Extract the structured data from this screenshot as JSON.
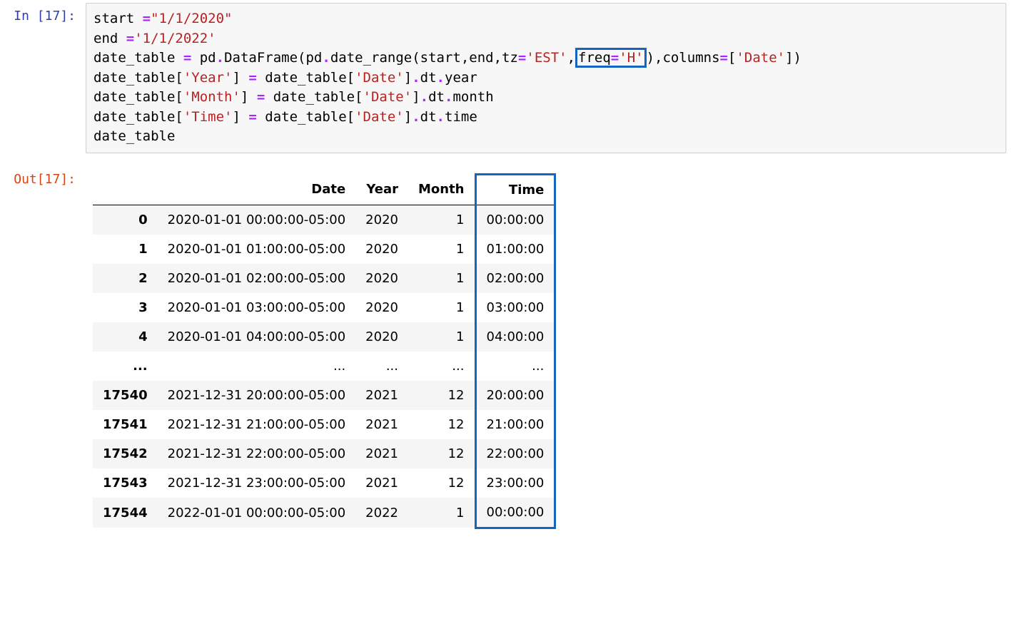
{
  "prompts": {
    "in_label": "In [17]:",
    "out_label": "Out[17]:"
  },
  "code": {
    "l1_a": "start ",
    "l1_eq": "=",
    "l1_b": "\"1/1/2020\"",
    "l2_a": "end ",
    "l2_eq": "=",
    "l2_b": "'1/1/2022'",
    "l3_a": "date_table ",
    "l3_eq": "=",
    "l3_b": " pd",
    "l3_c": ".",
    "l3_d": "DataFrame(pd",
    "l3_e": ".",
    "l3_f": "date_range(start,end,tz",
    "l3_eq2": "=",
    "l3_g": "'EST'",
    "l3_h": ",",
    "l3_hl_a": "freq",
    "l3_hl_eq": "=",
    "l3_hl_b": "'H'",
    "l3_i": "),columns",
    "l3_eq3": "=",
    "l3_j": "[",
    "l3_k": "'Date'",
    "l3_l": "])",
    "l4_a": "date_table[",
    "l4_b": "'Year'",
    "l4_c": "] ",
    "l4_eq": "=",
    "l4_d": " date_table[",
    "l4_e": "'Date'",
    "l4_f": "]",
    "l4_g": ".",
    "l4_h": "dt",
    "l4_i": ".",
    "l4_j": "year",
    "l5_a": "date_table[",
    "l5_b": "'Month'",
    "l5_c": "] ",
    "l5_eq": "=",
    "l5_d": " date_table[",
    "l5_e": "'Date'",
    "l5_f": "]",
    "l5_g": ".",
    "l5_h": "dt",
    "l5_i": ".",
    "l5_j": "month",
    "l6_a": "date_table[",
    "l6_b": "'Time'",
    "l6_c": "] ",
    "l6_eq": "=",
    "l6_d": " date_table[",
    "l6_e": "'Date'",
    "l6_f": "]",
    "l6_g": ".",
    "l6_h": "dt",
    "l6_i": ".",
    "l6_j": "time",
    "l7": "date_table"
  },
  "table": {
    "headers": [
      "",
      "Date",
      "Year",
      "Month",
      "Time"
    ],
    "rows": [
      {
        "idx": "0",
        "date": "2020-01-01 00:00:00-05:00",
        "year": "2020",
        "month": "1",
        "time": "00:00:00"
      },
      {
        "idx": "1",
        "date": "2020-01-01 01:00:00-05:00",
        "year": "2020",
        "month": "1",
        "time": "01:00:00"
      },
      {
        "idx": "2",
        "date": "2020-01-01 02:00:00-05:00",
        "year": "2020",
        "month": "1",
        "time": "02:00:00"
      },
      {
        "idx": "3",
        "date": "2020-01-01 03:00:00-05:00",
        "year": "2020",
        "month": "1",
        "time": "03:00:00"
      },
      {
        "idx": "4",
        "date": "2020-01-01 04:00:00-05:00",
        "year": "2020",
        "month": "1",
        "time": "04:00:00"
      },
      {
        "idx": "...",
        "date": "...",
        "year": "...",
        "month": "...",
        "time": "...",
        "ellipsis": true
      },
      {
        "idx": "17540",
        "date": "2021-12-31 20:00:00-05:00",
        "year": "2021",
        "month": "12",
        "time": "20:00:00"
      },
      {
        "idx": "17541",
        "date": "2021-12-31 21:00:00-05:00",
        "year": "2021",
        "month": "12",
        "time": "21:00:00"
      },
      {
        "idx": "17542",
        "date": "2021-12-31 22:00:00-05:00",
        "year": "2021",
        "month": "12",
        "time": "22:00:00"
      },
      {
        "idx": "17543",
        "date": "2021-12-31 23:00:00-05:00",
        "year": "2021",
        "month": "12",
        "time": "23:00:00"
      },
      {
        "idx": "17544",
        "date": "2022-01-01 00:00:00-05:00",
        "year": "2022",
        "month": "1",
        "time": "00:00:00"
      }
    ]
  }
}
